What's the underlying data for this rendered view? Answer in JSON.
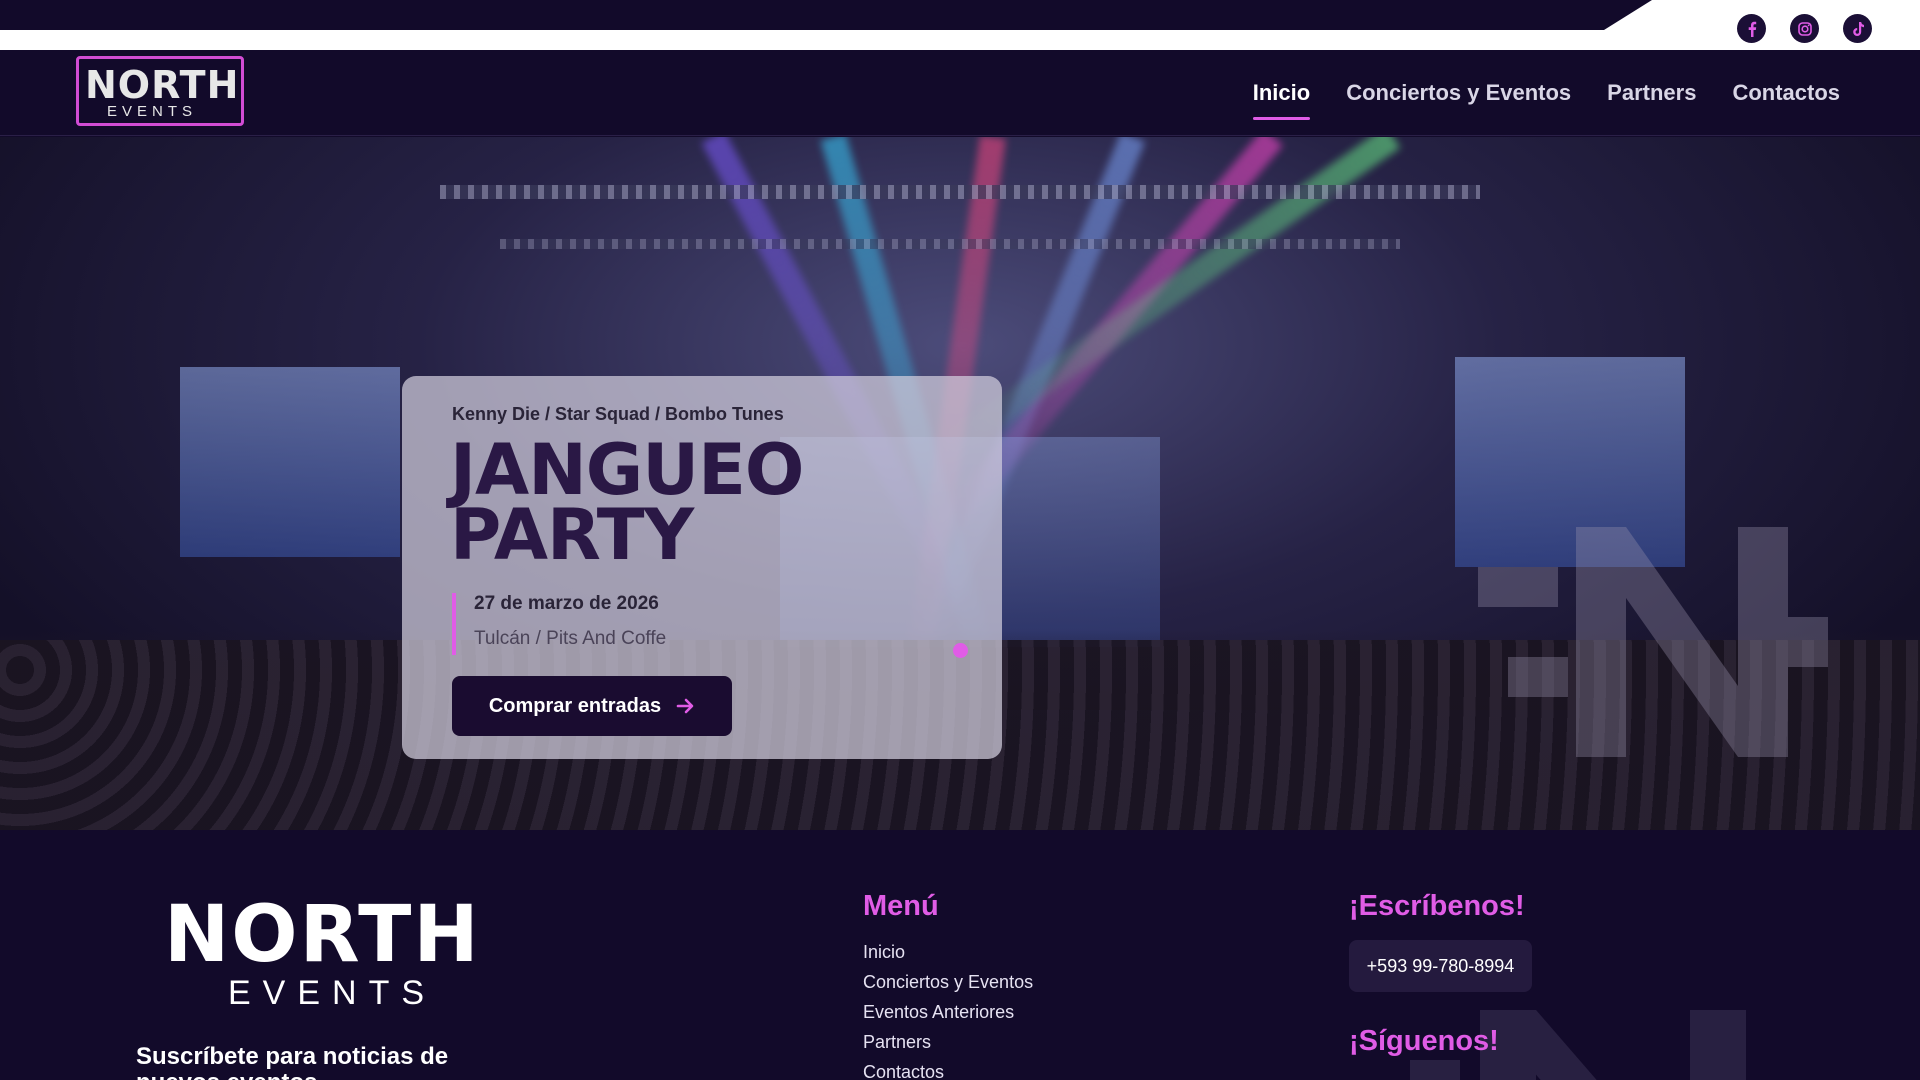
{
  "nav": {
    "logo_top": "NORTH",
    "logo_bottom": "EVENTS",
    "items": [
      {
        "label": "Inicio"
      },
      {
        "label": "Conciertos y Eventos"
      },
      {
        "label": "Partners"
      },
      {
        "label": "Contactos"
      }
    ],
    "active_item": "Inicio"
  },
  "socials": [
    "facebook-icon",
    "instagram-icon",
    "tiktok-icon"
  ],
  "hero": {
    "artists": "Kenny Die / Star Squad / Bombo Tunes",
    "title_line1": "JANGUEO",
    "title_line2": "PARTY",
    "date": "27 de marzo de 2026",
    "place": "Tulcán / Pits And Coffe",
    "cta_label": "Comprar entradas",
    "slides_total": 1,
    "active_slide": 1
  },
  "footer": {
    "logo_top": "NORTH",
    "logo_bottom": "EVENTS",
    "subscribe_text": "Suscríbete para noticias de nuevos eventos",
    "menu_title": "Menú",
    "menu_items": [
      {
        "label": "Inicio"
      },
      {
        "label": "Conciertos y Eventos"
      },
      {
        "label": "Eventos Anteriores"
      },
      {
        "label": "Partners"
      },
      {
        "label": "Contactos"
      }
    ],
    "write_title": "¡Escríbenos!",
    "phone": "+593 99-780-8994",
    "follow_title": "¡Síguenos!"
  },
  "colors": {
    "background": "#120a2a",
    "accent": "#e05ce6",
    "button": "#1a0c30"
  }
}
